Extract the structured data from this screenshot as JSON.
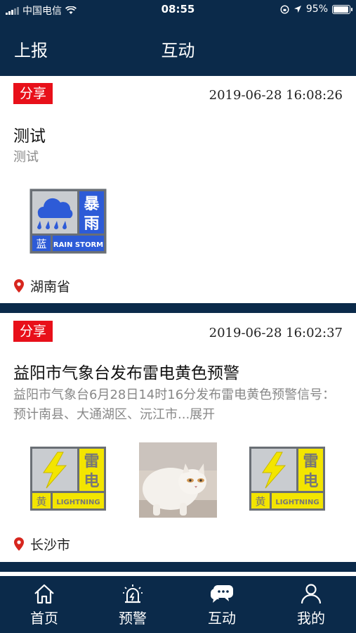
{
  "status": {
    "carrier": "中国电信",
    "time": "08:55",
    "battery": "95%",
    "battery_level": 0.95
  },
  "nav": {
    "report_label": "上报",
    "title": "互动"
  },
  "posts": [
    {
      "tag": "分享",
      "time": "2019-06-28 16:08:26",
      "title": "测试",
      "desc": "测试",
      "images": [
        {
          "kind": "rainstorm-warning-blue",
          "label_cn_1": "暴",
          "label_cn_2": "雨",
          "level_cn": "蓝",
          "label_en": "RAIN STORM"
        }
      ],
      "location": "湖南省"
    },
    {
      "tag": "分享",
      "time": "2019-06-28 16:02:37",
      "title": "益阳市气象台发布雷电黄色预警",
      "desc": "益阳市气象台6月28日14时16分发布雷电黄色预警信号：预计南县、大通湖区、沅江市...展开",
      "images": [
        {
          "kind": "lightning-warning-yellow",
          "label_cn_1": "雷",
          "label_cn_2": "电",
          "level_cn": "黄",
          "label_en": "LIGHTNING"
        },
        {
          "kind": "cat-photo"
        },
        {
          "kind": "lightning-warning-yellow",
          "label_cn_1": "雷",
          "label_cn_2": "电",
          "level_cn": "黄",
          "label_en": "LIGHTNING"
        }
      ],
      "location": "长沙市"
    }
  ],
  "tabs": [
    {
      "label": "首页",
      "icon": "home-icon"
    },
    {
      "label": "预警",
      "icon": "alarm-icon"
    },
    {
      "label": "互动",
      "icon": "chat-icon"
    },
    {
      "label": "我的",
      "icon": "user-icon"
    }
  ],
  "colors": {
    "navy": "#0b2a4a",
    "tag_red": "#e8101a",
    "warning_blue": "#2d5bd7",
    "warning_yellow": "#f3e500"
  }
}
